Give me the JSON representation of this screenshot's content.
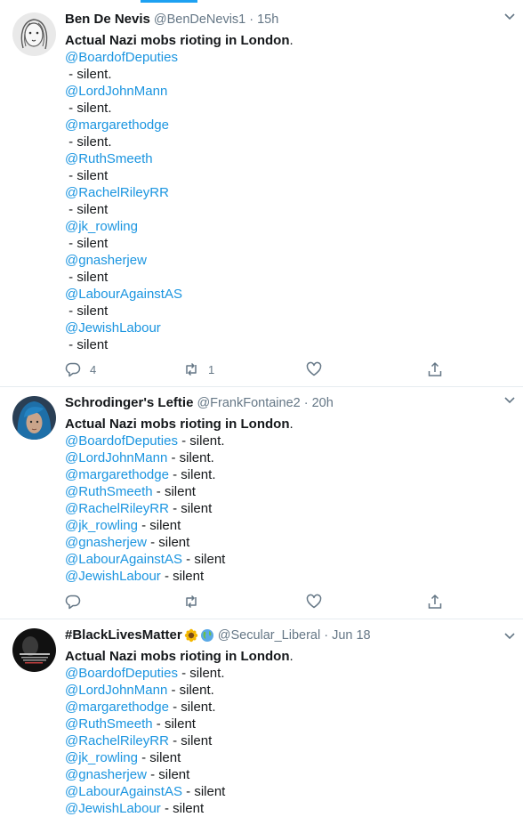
{
  "tweets": [
    {
      "name": "Ben De Nevis",
      "handle": "@BenDeNevis1",
      "dot": "·",
      "time": "15h",
      "headline": "Actual Nazi mobs rioting in London",
      "headline_suffix": ".",
      "lines": [
        {
          "mention": "@BoardofDeputies"
        },
        {
          "text": " - silent."
        },
        {
          "mention": "@LordJohnMann"
        },
        {
          "text": " - silent."
        },
        {
          "mention": "@margarethodge"
        },
        {
          "text": " - silent."
        },
        {
          "mention": "@RuthSmeeth"
        },
        {
          "text": " - silent"
        },
        {
          "mention": "@RachelRileyRR"
        },
        {
          "text": " - silent"
        },
        {
          "mention": "@jk_rowling"
        },
        {
          "text": " - silent"
        },
        {
          "mention": "@gnasherjew"
        },
        {
          "text": " - silent"
        },
        {
          "mention": "@LabourAgainstAS"
        },
        {
          "text": " - silent"
        },
        {
          "mention": "@JewishLabour"
        },
        {
          "text": " - silent"
        }
      ],
      "actions": {
        "replies": "4",
        "retweets": "1",
        "likes": ""
      },
      "avatar_colors": {
        "bg": "#e9e9e9",
        "ink": "#5a5a5a"
      }
    },
    {
      "name": "Schrodinger's Leftie",
      "handle": "@FrankFontaine2",
      "dot": "·",
      "time": "20h",
      "headline": "Actual Nazi mobs rioting in London",
      "headline_suffix": ".",
      "lines": [
        {
          "mention": "@BoardofDeputies",
          "text": " - silent."
        },
        {
          "mention": "@LordJohnMann",
          "text": " - silent."
        },
        {
          "mention": "@margarethodge",
          "text": " - silent."
        },
        {
          "mention": "@RuthSmeeth",
          "text": " - silent"
        },
        {
          "mention": "@RachelRileyRR",
          "text": " - silent"
        },
        {
          "mention": "@jk_rowling",
          "text": " - silent"
        },
        {
          "mention": "@gnasherjew",
          "text": " - silent"
        },
        {
          "mention": "@LabourAgainstAS",
          "text": " - silent"
        },
        {
          "mention": "@JewishLabour",
          "text": " - silent"
        }
      ],
      "actions": {
        "replies": "",
        "retweets": "",
        "likes": ""
      },
      "avatar_colors": {
        "hair": "#1e6fa8",
        "skin": "#caa48a",
        "bg": "#2a3f55"
      }
    },
    {
      "name": "#BlackLivesMatter",
      "name_emojis": [
        "sunflower",
        "globe"
      ],
      "handle": "@Secular_Liberal",
      "dot": "·",
      "time": "Jun 18",
      "headline": "Actual Nazi mobs rioting in London",
      "headline_suffix": ".",
      "lines": [
        {
          "mention": "@BoardofDeputies",
          "text": " - silent."
        },
        {
          "mention": "@LordJohnMann",
          "text": " - silent."
        },
        {
          "mention": "@margarethodge",
          "text": " - silent."
        },
        {
          "mention": "@RuthSmeeth",
          "text": " - silent"
        },
        {
          "mention": "@RachelRileyRR",
          "text": " - silent"
        },
        {
          "mention": "@jk_rowling",
          "text": " - silent"
        },
        {
          "mention": "@gnasherjew",
          "text": " - silent"
        },
        {
          "mention": "@LabourAgainstAS",
          "text": " - silent"
        },
        {
          "mention": "@JewishLabour",
          "text": " - silent"
        }
      ],
      "avatar_colors": {
        "bg": "#111111"
      }
    }
  ],
  "colors": {
    "accent": "#1da1f2",
    "mention": "#1b95e0",
    "muted": "#657786",
    "divider": "#e6ecf0"
  },
  "icons": [
    "reply-icon",
    "retweet-icon",
    "like-icon",
    "share-icon",
    "chevron-down-icon"
  ]
}
